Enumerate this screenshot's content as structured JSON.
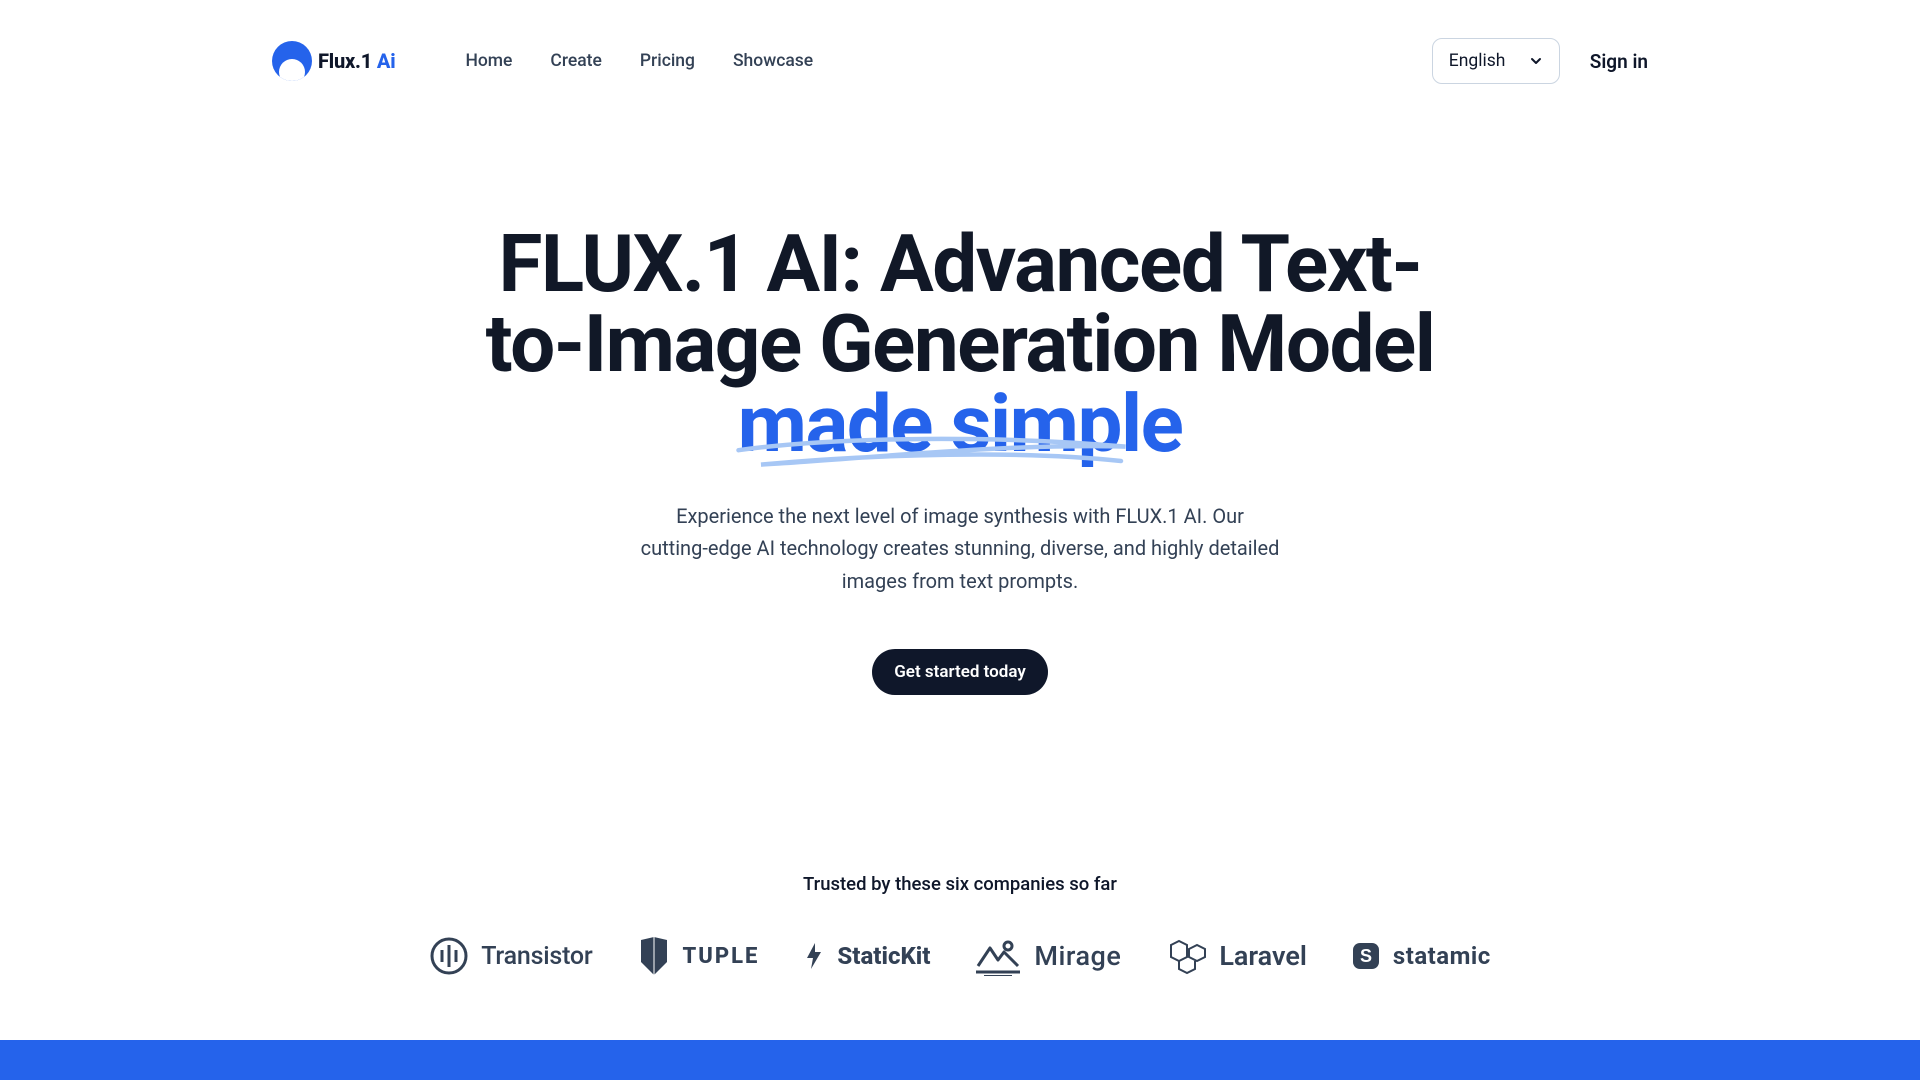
{
  "brand": {
    "name_main": "Flux.1 ",
    "name_accent": "Ai"
  },
  "nav": {
    "home": "Home",
    "create": "Create",
    "pricing": "Pricing",
    "showcase": "Showcase"
  },
  "header": {
    "language_selected": "English",
    "signin": "Sign in"
  },
  "hero": {
    "title_main": "FLUX.1 AI: Advanced Text-to-Image Generation Model ",
    "title_emph": "made simple",
    "subtitle": "Experience the next level of image synthesis with FLUX.1 AI. Our cutting-edge AI technology creates stunning, diverse, and highly detailed images from text prompts.",
    "cta": "Get started today"
  },
  "trusted": {
    "heading": "Trusted by these six companies so far",
    "companies": {
      "transistor": "Transistor",
      "tuple": "TUPLE",
      "statickit": "StaticKit",
      "mirage": "Mirage",
      "laravel": "Laravel",
      "statamic": "statamic"
    }
  },
  "colors": {
    "accent": "#2563eb",
    "text": "#0f172a",
    "muted": "#334155",
    "scribble": "#a7c7f5"
  }
}
